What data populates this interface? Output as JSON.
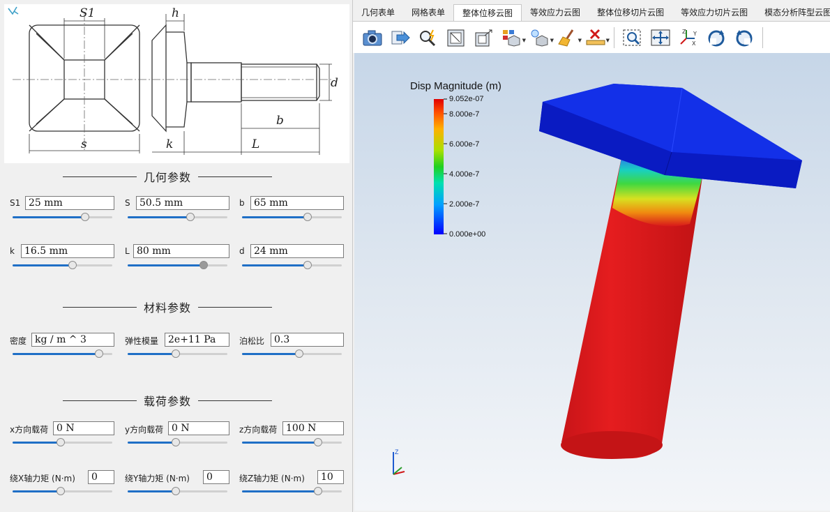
{
  "drawing": {
    "labels": {
      "s1": "S1",
      "h": "h",
      "d": "d",
      "b": "b",
      "s": "s",
      "k": "k",
      "L": "L"
    }
  },
  "geometry": {
    "title": "几何参数",
    "params": [
      {
        "label": "S1",
        "value": "25 mm",
        "level": 0.73
      },
      {
        "label": "S",
        "value": "50.5 mm",
        "level": 0.63
      },
      {
        "label": "b",
        "value": "65 mm",
        "level": 0.66
      },
      {
        "label": "k",
        "value": "16.5 mm",
        "level": 0.6
      },
      {
        "label": "L",
        "value": "80 mm",
        "level": 0.76
      },
      {
        "label": "d",
        "value": "24 mm",
        "level": 0.66
      }
    ]
  },
  "material": {
    "title": "材料参数",
    "params": [
      {
        "label": "密度",
        "value": "kg / m ^ 3",
        "level": 0.87
      },
      {
        "label": "弹性模量",
        "value": "2e+11 Pa",
        "level": 0.48
      },
      {
        "label": "泊松比",
        "value": "0.3",
        "level": 0.57
      }
    ]
  },
  "load": {
    "title": "载荷参数",
    "params": [
      {
        "label": "x方向载荷",
        "value": "0 N",
        "level": 0.48
      },
      {
        "label": "y方向载荷",
        "value": "0 N",
        "level": 0.48
      },
      {
        "label": "z方向载荷",
        "value": "100 N",
        "level": 0.76
      },
      {
        "label": "绕X轴力矩 (N·m)",
        "value": "0",
        "level": 0.48
      },
      {
        "label": "绕Y轴力矩 (N·m)",
        "value": "0",
        "level": 0.48
      },
      {
        "label": "绕Z轴力矩 (N·m)",
        "value": "10",
        "level": 0.76
      }
    ]
  },
  "tabs": [
    "几何表单",
    "网格表单",
    "整体位移云图",
    "等效应力云图",
    "整体位移切片云图",
    "等效应力切片云图",
    "模态分析阵型云图"
  ],
  "active_tab": "整体位移云图",
  "toolbar_icons": [
    "camera-icon",
    "export-icon",
    "zoom-inspect-icon",
    "reset-view-icon",
    "fit-view-icon",
    "display-mode-icon",
    "light-icon",
    "clear-brush-icon",
    "measure-icon",
    "box-zoom-icon",
    "pan-icon",
    "axes-icon",
    "rotate-cw-icon",
    "rotate-ccw-icon"
  ],
  "colorbar": {
    "title": "Disp Magnitude (m)",
    "max_label": "9.052e-07",
    "ticks": [
      "8.000e-7",
      "6.000e-7",
      "4.000e-7",
      "2.000e-7",
      "0.000e+00"
    ]
  },
  "axes_triad": {
    "z": "Z"
  },
  "colors": {
    "accent": "#1f6fc6",
    "head": "#0a1fd6",
    "shank": "#d8161a"
  }
}
